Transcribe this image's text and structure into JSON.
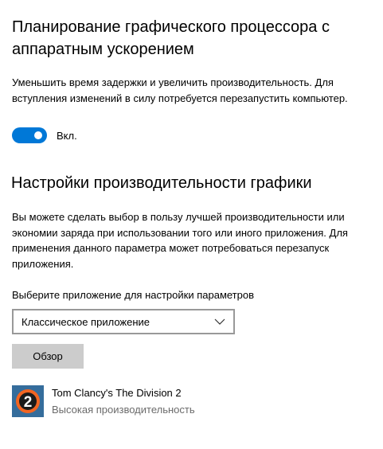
{
  "hardware_scheduling": {
    "title": "Планирование графического процессора с аппаратным ускорением",
    "description": "Уменьшить время задержки и увеличить производительность. Для вступления изменений в силу потребуется перезапустить компьютер.",
    "toggle_state": "on",
    "toggle_label": "Вкл."
  },
  "graphics_performance": {
    "title": "Настройки производительности графики",
    "description": "Вы можете сделать выбор в пользу лучшей производительности или экономии заряда при использовании того или иного приложения. Для применения данного параметра может потребоваться перезапуск приложения.",
    "select_label": "Выберите приложение для настройки параметров",
    "select_value": "Классическое приложение",
    "browse_button": "Обзор",
    "apps": [
      {
        "name": "Tom Clancy's The Division 2",
        "preference": "Высокая производительность",
        "icon": "division-2-icon"
      }
    ]
  },
  "colors": {
    "accent": "#0078d7",
    "secondary_text": "#6b6b6b",
    "button_bg": "#cccccc",
    "icon_orange": "#f26522"
  }
}
